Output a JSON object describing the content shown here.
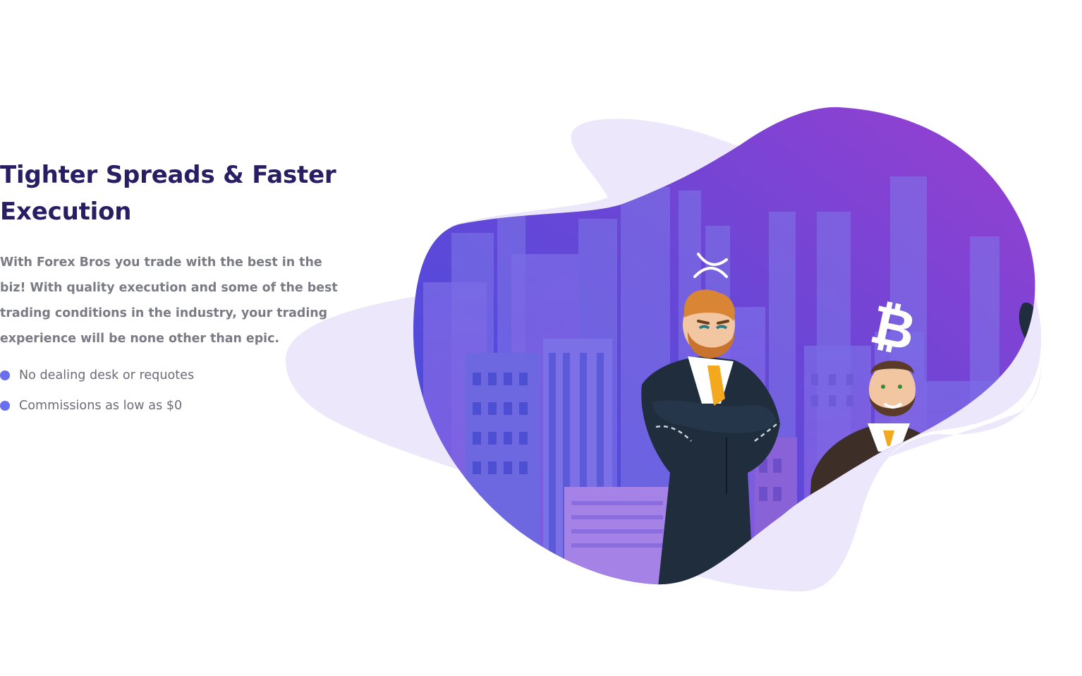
{
  "section": {
    "title": "Tighter Spreads & Faster Execution",
    "description": "With Forex Bros you trade with the best in the biz! With quality execution and some of the best trading conditions in the industry, your trading experience will be none other than epic.",
    "features": [
      {
        "label": "No dealing desk or requotes"
      },
      {
        "label": "Commissions as low as $0"
      }
    ]
  },
  "illustration": {
    "icons": [
      "ripple-icon",
      "bitcoin-icon"
    ],
    "colors": {
      "title": "#281e63",
      "text": "#7b7b86",
      "bullet": "#6a6ff0",
      "blob_light": "#ece7fb",
      "gradient_start": "#3a4fe0",
      "gradient_end": "#9b3fd0",
      "suit": "#1f2d3d",
      "beard": "#c8742f",
      "tie": "#f3a91d"
    }
  }
}
